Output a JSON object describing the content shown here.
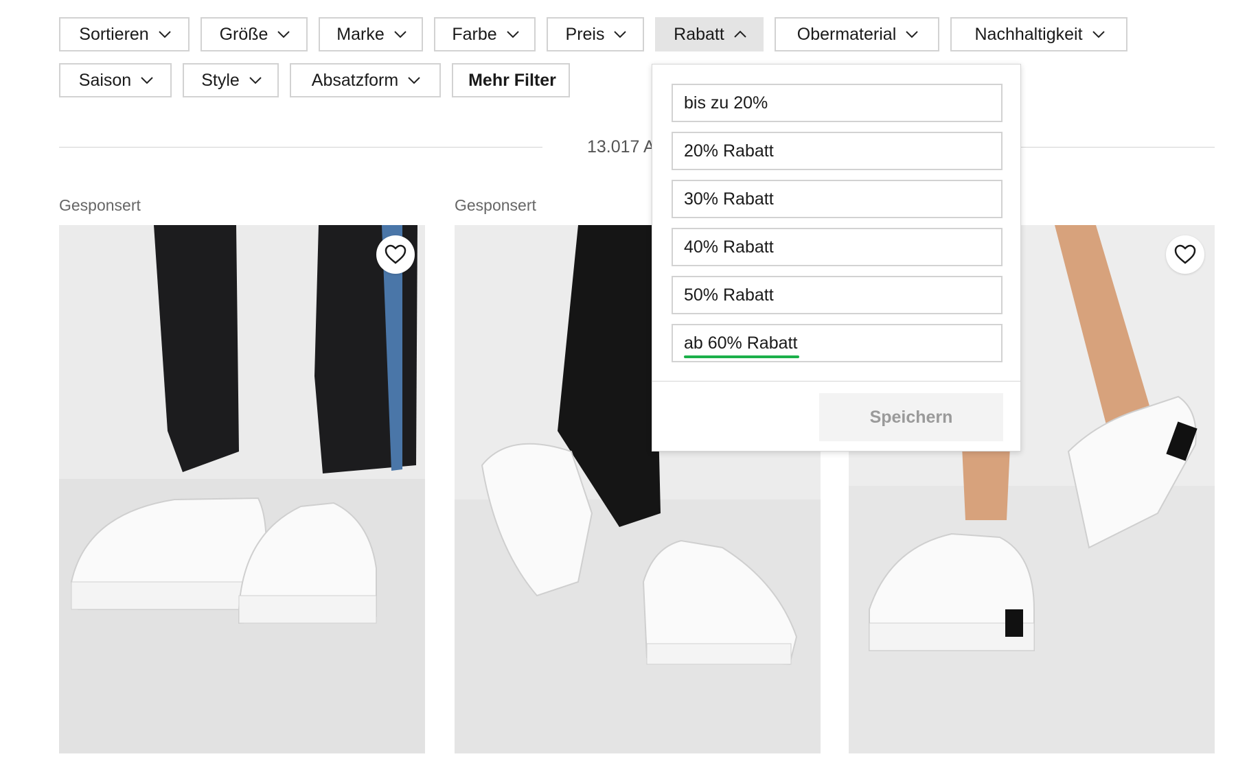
{
  "filters_row1": [
    {
      "label": "Sortieren",
      "state": "closed"
    },
    {
      "label": "Größe",
      "state": "closed"
    },
    {
      "label": "Marke",
      "state": "closed"
    },
    {
      "label": "Farbe",
      "state": "closed"
    },
    {
      "label": "Preis",
      "state": "closed"
    },
    {
      "label": "Rabatt",
      "state": "open"
    },
    {
      "label": "Obermaterial",
      "state": "closed"
    },
    {
      "label": "Nachhaltigkeit",
      "state": "closed"
    }
  ],
  "filters_row2": [
    {
      "label": "Saison"
    },
    {
      "label": "Style"
    },
    {
      "label": "Absatzform"
    },
    {
      "label": "Mehr Filter"
    }
  ],
  "result_count": "13.017 A",
  "products": [
    {
      "sponsored": "Gesponsert",
      "heart_icon": "heart-outline-icon"
    },
    {
      "sponsored": "Gesponsert"
    },
    {
      "heart_icon": "heart-outline-icon"
    }
  ],
  "rabatt_dropdown": {
    "options": [
      "bis zu 20%",
      "20% Rabatt",
      "30% Rabatt",
      "40% Rabatt",
      "50% Rabatt",
      "ab 60% Rabatt"
    ],
    "highlighted_option": "ab 60% Rabatt",
    "highlight_color": "#1bb04a",
    "save_label": "Speichern"
  },
  "colors": {
    "active_filter_bg": "#e4e4e4",
    "border": "#d2d2d2"
  }
}
